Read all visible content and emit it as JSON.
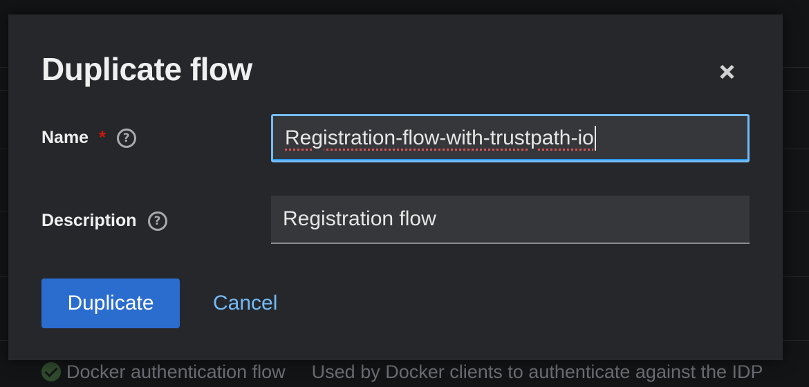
{
  "background": {
    "row_name": "Docker authentication flow",
    "row_description": "Used by Docker clients to authenticate against the IDP"
  },
  "modal": {
    "title": "Duplicate flow",
    "name_label": "Name",
    "required_mark": "*",
    "name_value": "Registration-flow-with-trustpath-io",
    "description_label": "Description",
    "description_value": "Registration flow",
    "help_glyph": "?",
    "primary_button": "Duplicate",
    "cancel_button": "Cancel"
  },
  "icons": {
    "close": "close-icon",
    "help": "help-icon",
    "check": "check-circle-icon"
  },
  "colors": {
    "primary": "#2b6ccf",
    "link": "#73bcf7",
    "required": "#c9190b",
    "modal_bg": "#26272b"
  }
}
